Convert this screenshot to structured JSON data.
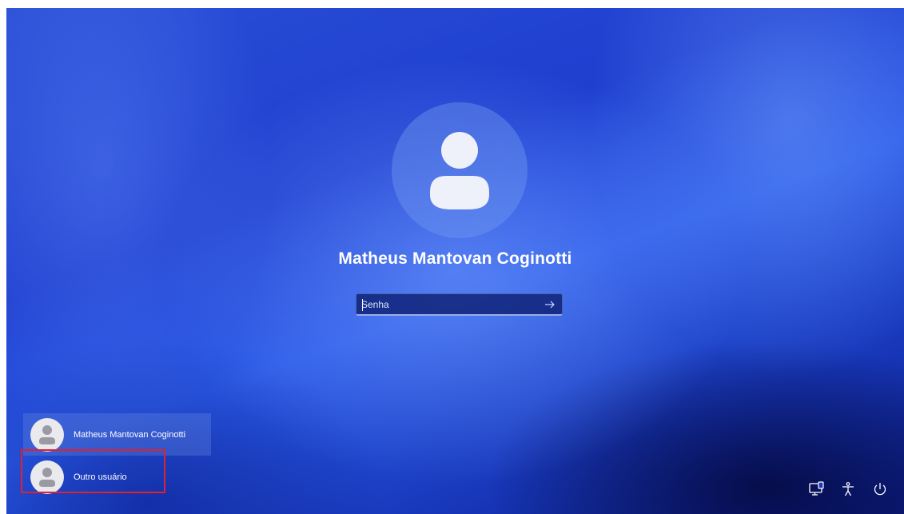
{
  "login": {
    "user_name": "Matheus Mantovan Coginotti",
    "password_placeholder": "Senha",
    "password_value": "",
    "submit_icon": "arrow-right-icon",
    "avatar_icon": "user-icon"
  },
  "user_list": {
    "items": [
      {
        "label": "Matheus Mantovan Coginotti",
        "icon": "user-icon",
        "selected": true
      },
      {
        "label": "Outro usuário",
        "icon": "user-icon",
        "selected": false
      }
    ]
  },
  "system_icons": {
    "network": "network-icon",
    "accessibility": "accessibility-icon",
    "power": "power-icon"
  },
  "colors": {
    "highlight": "#e0212e",
    "text": "#ffffff"
  }
}
